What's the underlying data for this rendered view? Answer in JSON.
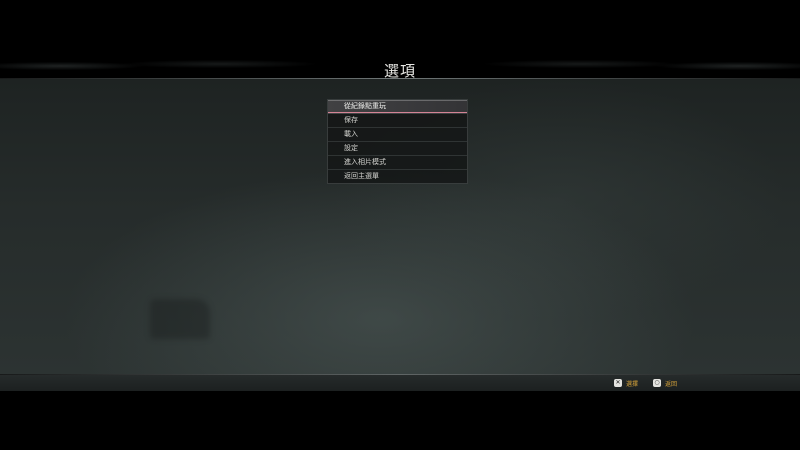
{
  "header": {
    "title": "選項"
  },
  "menu": {
    "items": [
      {
        "label": "從紀錄點重玩",
        "selected": true
      },
      {
        "label": "保存",
        "selected": false
      },
      {
        "label": "載入",
        "selected": false
      },
      {
        "label": "設定",
        "selected": false
      },
      {
        "label": "進入相片模式",
        "selected": false
      },
      {
        "label": "返回主選單",
        "selected": false
      }
    ]
  },
  "footer": {
    "hints": [
      {
        "icon": "cross-button-icon",
        "label": "選擇"
      },
      {
        "icon": "circle-button-icon",
        "label": "返回"
      }
    ]
  },
  "colors": {
    "hint_label": "#d9a53a",
    "selection_accent": "#e68ca0"
  }
}
